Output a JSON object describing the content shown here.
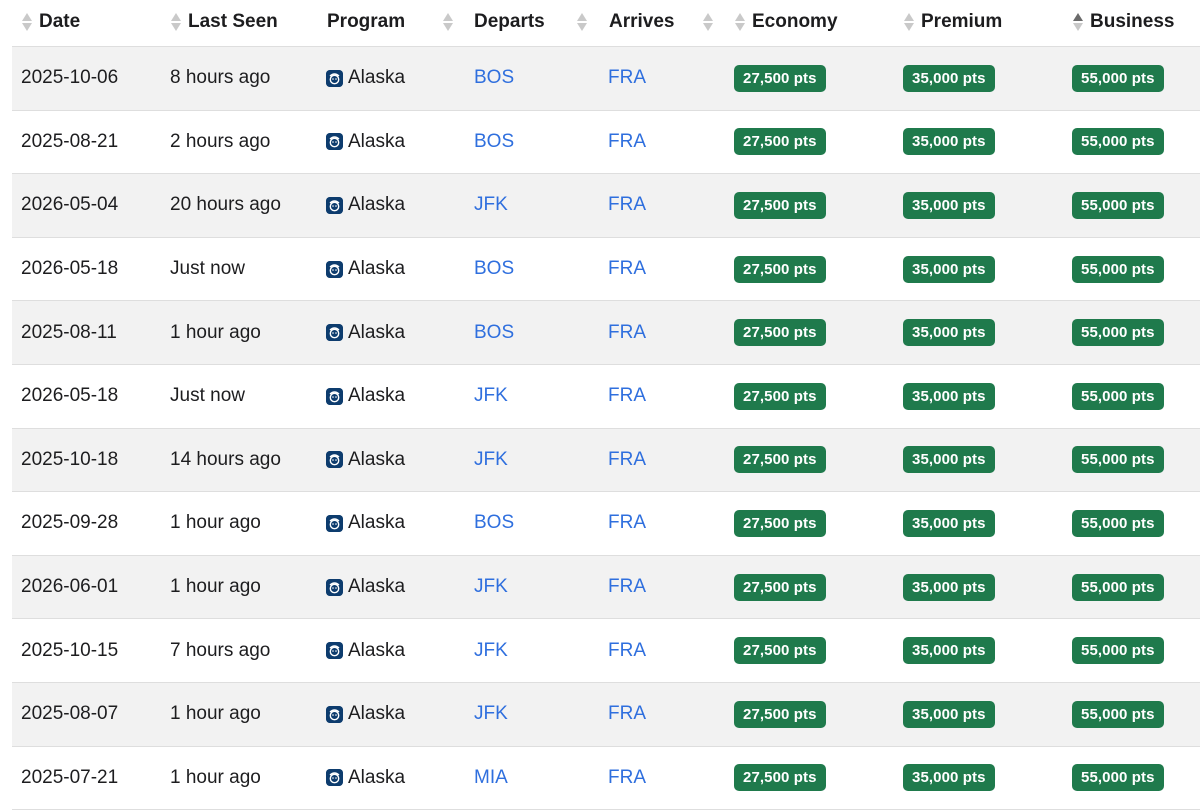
{
  "columns": {
    "date": "Date",
    "last_seen": "Last Seen",
    "program": "Program",
    "departs": "Departs",
    "arrives": "Arrives",
    "economy": "Economy",
    "premium": "Premium",
    "business": "Business"
  },
  "sort": {
    "column": "business",
    "direction": "ascending"
  },
  "icons": {
    "program": "alaska-airlines-logo-icon",
    "sort": "sort-arrows-icon"
  },
  "colors": {
    "link": "#2f6fde",
    "pill": "#1f7a4c",
    "row_alt": "#f2f2f2"
  },
  "rows": [
    {
      "date": "2025-10-06",
      "last_seen": "8 hours ago",
      "program": "Alaska",
      "departs": "BOS",
      "arrives": "FRA",
      "economy": "27,500 pts",
      "premium": "35,000 pts",
      "business": "55,000 pts"
    },
    {
      "date": "2025-08-21",
      "last_seen": "2 hours ago",
      "program": "Alaska",
      "departs": "BOS",
      "arrives": "FRA",
      "economy": "27,500 pts",
      "premium": "35,000 pts",
      "business": "55,000 pts"
    },
    {
      "date": "2026-05-04",
      "last_seen": "20 hours ago",
      "program": "Alaska",
      "departs": "JFK",
      "arrives": "FRA",
      "economy": "27,500 pts",
      "premium": "35,000 pts",
      "business": "55,000 pts"
    },
    {
      "date": "2026-05-18",
      "last_seen": "Just now",
      "program": "Alaska",
      "departs": "BOS",
      "arrives": "FRA",
      "economy": "27,500 pts",
      "premium": "35,000 pts",
      "business": "55,000 pts"
    },
    {
      "date": "2025-08-11",
      "last_seen": "1 hour ago",
      "program": "Alaska",
      "departs": "BOS",
      "arrives": "FRA",
      "economy": "27,500 pts",
      "premium": "35,000 pts",
      "business": "55,000 pts"
    },
    {
      "date": "2026-05-18",
      "last_seen": "Just now",
      "program": "Alaska",
      "departs": "JFK",
      "arrives": "FRA",
      "economy": "27,500 pts",
      "premium": "35,000 pts",
      "business": "55,000 pts"
    },
    {
      "date": "2025-10-18",
      "last_seen": "14 hours ago",
      "program": "Alaska",
      "departs": "JFK",
      "arrives": "FRA",
      "economy": "27,500 pts",
      "premium": "35,000 pts",
      "business": "55,000 pts"
    },
    {
      "date": "2025-09-28",
      "last_seen": "1 hour ago",
      "program": "Alaska",
      "departs": "BOS",
      "arrives": "FRA",
      "economy": "27,500 pts",
      "premium": "35,000 pts",
      "business": "55,000 pts"
    },
    {
      "date": "2026-06-01",
      "last_seen": "1 hour ago",
      "program": "Alaska",
      "departs": "JFK",
      "arrives": "FRA",
      "economy": "27,500 pts",
      "premium": "35,000 pts",
      "business": "55,000 pts"
    },
    {
      "date": "2025-10-15",
      "last_seen": "7 hours ago",
      "program": "Alaska",
      "departs": "JFK",
      "arrives": "FRA",
      "economy": "27,500 pts",
      "premium": "35,000 pts",
      "business": "55,000 pts"
    },
    {
      "date": "2025-08-07",
      "last_seen": "1 hour ago",
      "program": "Alaska",
      "departs": "JFK",
      "arrives": "FRA",
      "economy": "27,500 pts",
      "premium": "35,000 pts",
      "business": "55,000 pts"
    },
    {
      "date": "2025-07-21",
      "last_seen": "1 hour ago",
      "program": "Alaska",
      "departs": "MIA",
      "arrives": "FRA",
      "economy": "27,500 pts",
      "premium": "35,000 pts",
      "business": "55,000 pts"
    }
  ]
}
